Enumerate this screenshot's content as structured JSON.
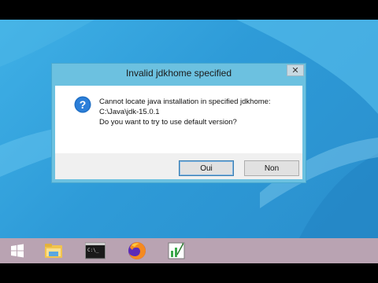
{
  "dialog": {
    "title": "Invalid jdkhome specified",
    "close_label": "✕",
    "message_lines": [
      "Cannot locate java installation in specified jdkhome:",
      "C:\\Java\\jdk-15.0.1",
      "Do you want to try to use default version?"
    ],
    "buttons": {
      "yes": "Oui",
      "no": "Non"
    }
  },
  "taskbar": {
    "items": [
      {
        "icon": "windows-start-icon"
      },
      {
        "icon": "file-explorer-icon"
      },
      {
        "icon": "command-prompt-icon"
      },
      {
        "icon": "firefox-icon"
      },
      {
        "icon": "spreadsheet-app-icon"
      }
    ],
    "cmd_label": "C:\\_"
  },
  "colors": {
    "desktop": "#2e9bd8",
    "taskbar": "#b9a3b2",
    "dialog_frame": "#6cc1e0",
    "accent": "#1f6fc5"
  }
}
